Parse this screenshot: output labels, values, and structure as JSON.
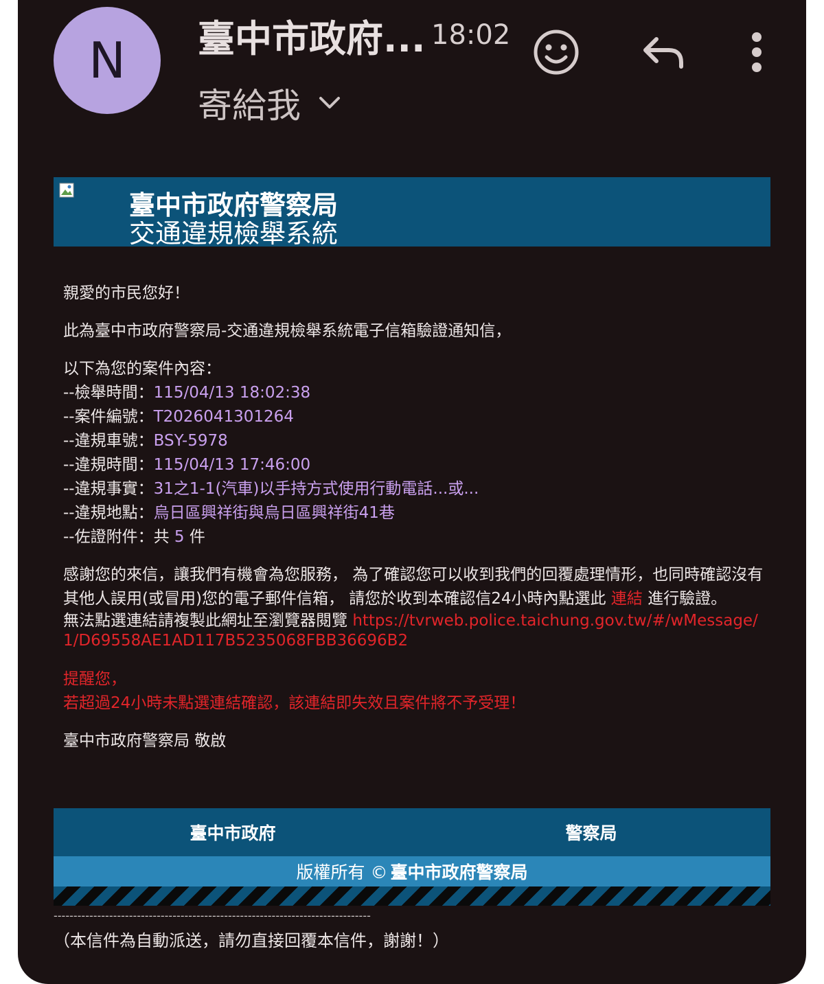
{
  "header": {
    "avatar_letter": "N",
    "sender": "臺中市政府...",
    "time": "18:02",
    "to_label": "寄給我"
  },
  "icons": {
    "emoji": "emoji-icon",
    "reply": "reply-icon",
    "more": "more-vert-icon",
    "chevron": "chevron-down-icon"
  },
  "banner": {
    "title1": "臺中市政府警察局",
    "title2": "交通違規檢舉系統"
  },
  "body": {
    "greeting": "親愛的市民您好！",
    "intro": "此為臺中市政府警察局-交通違規檢舉系統電子信箱驗證通知信，",
    "case_heading": "以下為您的案件內容：",
    "fields": [
      {
        "label": "--檢舉時間：",
        "value": "115/04/13 18:02:38"
      },
      {
        "label": "--案件編號：",
        "value": "T2026041301264"
      },
      {
        "label": "--違規車號：",
        "value": "BSY-5978"
      },
      {
        "label": "--違規時間：",
        "value": "115/04/13 17:46:00"
      },
      {
        "label": "--違規事實：",
        "value": "31之1-1(汽車)以手持方式使用行動電話...或..."
      },
      {
        "label": "--違規地點：",
        "value": "烏日區興祥街與烏日區興祥街41巷"
      }
    ],
    "attachments_label": "--佐證附件：共 ",
    "attachments_count": "5",
    "attachments_unit": " 件",
    "thanks_part1": "感謝您的來信，讓我們有機會為您服務， 為了確認您可以收到我們的回覆處理情形，也同時確認沒有其他人誤用(或冒用)您的電子郵件信箱， 請您於收到本確認信24小時內點選此 ",
    "link_text": "連結",
    "thanks_part2": " 進行驗證。",
    "copy_prompt": "無法點選連結請複製此網址至瀏覽器閱覽 ",
    "url": "https://tvrweb.police.taichung.gov.tw/#/wMessage/1/D69558AE1AD117B5235068FBB36696B2",
    "reminder_title": "提醒您，",
    "reminder_text": "若超過24小時未點選連結確認，該連結即失效且案件將不予受理！",
    "signature": "臺中市政府警察局 敬啟"
  },
  "footer": {
    "col1": "臺中市政府",
    "col2": "警察局",
    "copyright_prefix": "版權所有 © ",
    "copyright_owner": "臺中市政府警察局",
    "dashes": "--------------------------------------------------------------------------------",
    "auto_note": "（本信件為自動派送，請勿直接回覆本信件，謝謝！）"
  },
  "colors": {
    "background": "#1b1213",
    "banner": "#0c5379",
    "footer_light": "#2b86b8",
    "highlight_purple": "#c9a0ee",
    "alert_red": "#e2252a",
    "avatar": "#b7a3e0"
  }
}
